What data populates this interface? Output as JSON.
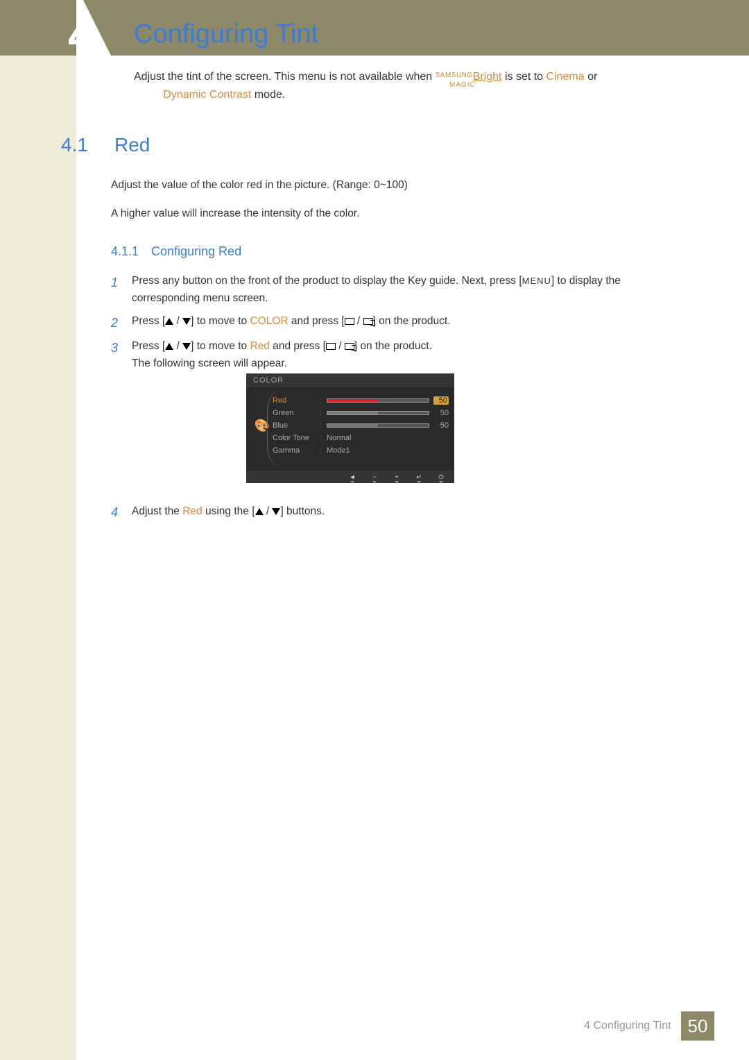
{
  "chapter_number_big": "4",
  "page_title": "Configuring Tint",
  "intro": {
    "part1": "Adjust the tint of the screen. This menu is not available when ",
    "magic_sup": "SAMSUNG",
    "magic_sub": "MAGIC",
    "bright": "Bright",
    "part2": " is set to ",
    "cinema": "Cinema",
    "part3": " or ",
    "dyn": "Dynamic Contrast",
    "part4": " mode."
  },
  "sec41": {
    "num": "4.1",
    "title": "Red"
  },
  "body1": "Adjust the value of the color red in the picture. (Range: 0~100)",
  "body2": "A higher value will increase the intensity of the color.",
  "subsec411": {
    "num": "4.1.1",
    "title": "Configuring Red"
  },
  "steps": {
    "s1n": "1",
    "s1a": "Press any button on the front of the product to display the Key guide. Next, press [",
    "s1menu": "MENU",
    "s1b": "] to display the corresponding menu screen.",
    "s2n": "2",
    "s2a": "Press [",
    "s2b": "] to move to ",
    "s2color": "COLOR",
    "s2c": " and press [",
    "s2d": "] on the product.",
    "s3n": "3",
    "s3a": "Press [",
    "s3b": "] to move to ",
    "s3red": "Red",
    "s3c": " and press [",
    "s3d": "] on the product.",
    "s3e": "The following screen will appear.",
    "s4n": "4",
    "s4a": "Adjust the ",
    "s4red": "Red",
    "s4b": " using the [",
    "s4c": "] buttons."
  },
  "osd": {
    "title": "COLOR",
    "rows": [
      {
        "label": "Red",
        "value": "50",
        "type": "slider",
        "active": true,
        "color": "red"
      },
      {
        "label": "Green",
        "value": "50",
        "type": "slider"
      },
      {
        "label": "Blue",
        "value": "50",
        "type": "slider"
      },
      {
        "label": "Color Tone",
        "value": "Normal",
        "type": "text"
      },
      {
        "label": "Gamma",
        "value": "Mode1",
        "type": "text"
      }
    ],
    "footer_icons": [
      "◄",
      "−",
      "+",
      "↵",
      "⏻"
    ]
  },
  "footer": {
    "chapter": "4 Configuring Tint",
    "page": "50"
  }
}
